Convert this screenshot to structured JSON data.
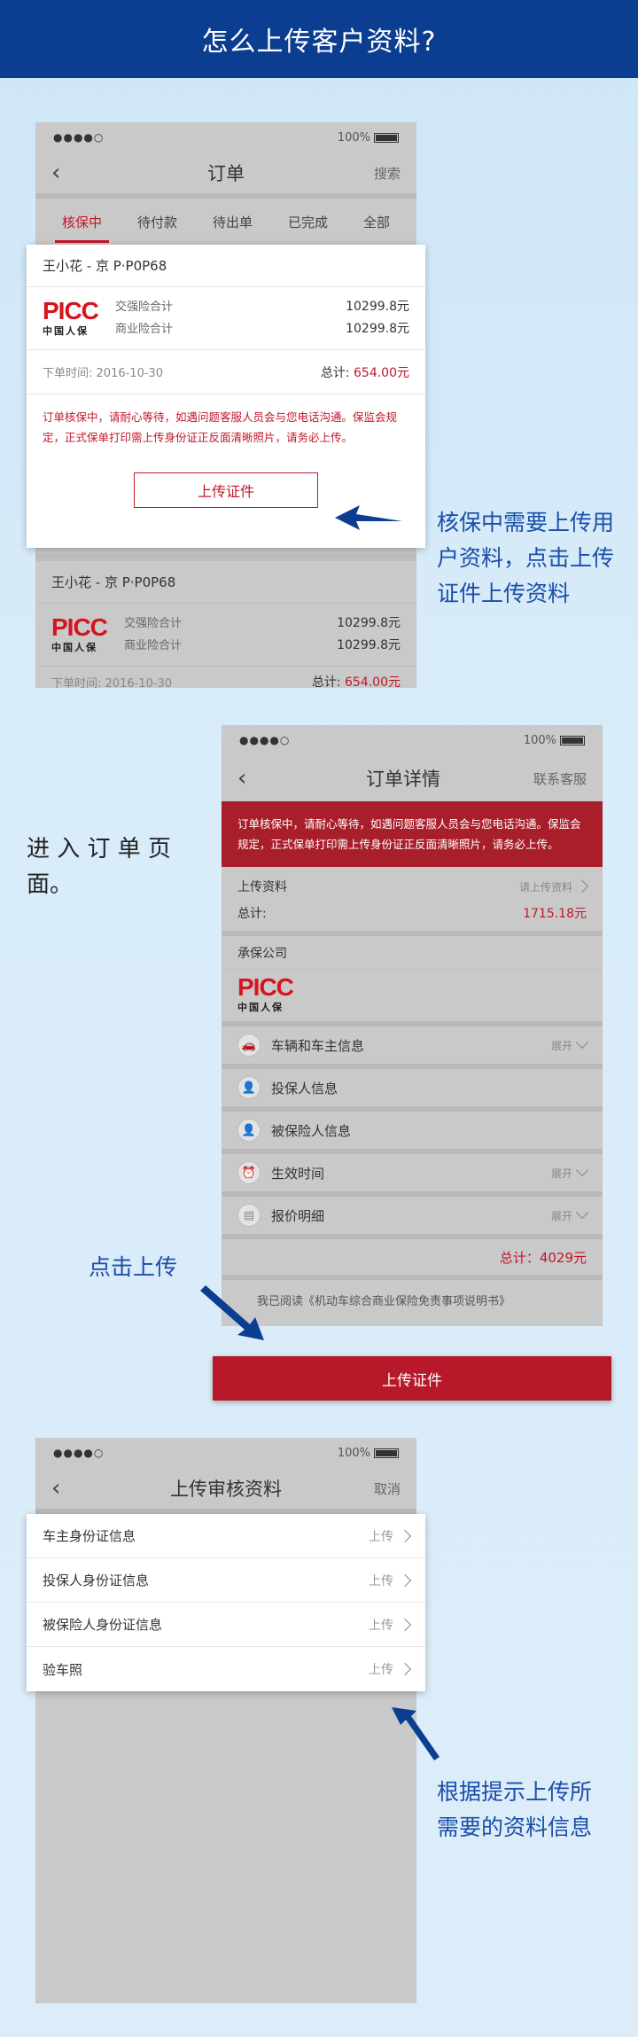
{
  "banner": {
    "title": "怎么上传客户资料?"
  },
  "statusbar": {
    "dots": "●●●●○",
    "battery": "100%"
  },
  "screen1": {
    "nav": {
      "back": "‹",
      "title": "订单",
      "right": "搜索"
    },
    "tabs": [
      "核保中",
      "待付款",
      "待出单",
      "已完成",
      "全部"
    ],
    "card1": {
      "name": "王小花 - 京 P·P0P68",
      "logo_word": "PICC",
      "logo_sub": "中国人保",
      "line1_label": "交强险合计",
      "line1_value": "10299.8元",
      "line2_label": "商业险合计",
      "line2_value": "10299.8元",
      "time_label": "下单时间:",
      "time_value": "2016-10-30",
      "total_label": "总计:",
      "total_value": "654.00元",
      "notice": "订单核保中，请耐心等待，如遇问题客服人员会与您电话沟通。保监会规定，正式保单打印需上传身份证正反面清晰照片，请务必上传。",
      "button": "上传证件"
    },
    "card2": {
      "name": "王小花 - 京 P·P0P68",
      "line1_label": "交强险合计",
      "line1_value": "10299.8元",
      "line2_label": "商业险合计",
      "line2_value": "10299.8元",
      "time_label": "下单时间:",
      "time_value": "2016-10-30",
      "total_label": "总计:",
      "total_value": "654.00元"
    },
    "callout": "核保中需要上传用户资料，点击上传证件上传资料"
  },
  "screen2": {
    "nav": {
      "back": "‹",
      "title": "订单详情",
      "right": "联系客服"
    },
    "redbar": "订单核保中，请耐心等待，如遇问题客服人员会与您电话沟通。保监会规定，正式保单打印需上传身份证正反面清晰照片，请务必上传。",
    "upload_label": "上传资料",
    "upload_hint": "请上传资料",
    "total_label": "总计:",
    "total_value": "1715.18元",
    "insurer_label": "承保公司",
    "sections": [
      {
        "label": "车辆和车主信息",
        "right": "展开",
        "icon": "car-icon"
      },
      {
        "label": "投保人信息",
        "right": "",
        "icon": "person-icon"
      },
      {
        "label": "被保险人信息",
        "right": "",
        "icon": "person-icon"
      },
      {
        "label": "生效时间",
        "right": "展开",
        "icon": "clock-icon"
      },
      {
        "label": "报价明细",
        "right": "展开",
        "icon": "receipt-icon"
      }
    ],
    "grand_total": "总计：4029元",
    "agree_text": "我已阅读《机动车综合商业保险免责事项说明书》",
    "button": "上传证件",
    "left_text": "进 入 订 单 页 面。",
    "click_text": "点击上传"
  },
  "screen3": {
    "nav": {
      "back": "‹",
      "title": "上传审核资料",
      "right": "取消"
    },
    "rows": [
      {
        "label": "车主身份证信息",
        "action": "上传"
      },
      {
        "label": "投保人身份证信息",
        "action": "上传"
      },
      {
        "label": "被保险人身份证信息",
        "action": "上传"
      },
      {
        "label": "验车照",
        "action": "上传"
      }
    ],
    "callout": "根据提示上传所需要的资料信息"
  },
  "colors": {
    "brand_blue": "#0b3d91",
    "accent_red": "#c0172a",
    "callout_blue": "#1a4ea8"
  }
}
